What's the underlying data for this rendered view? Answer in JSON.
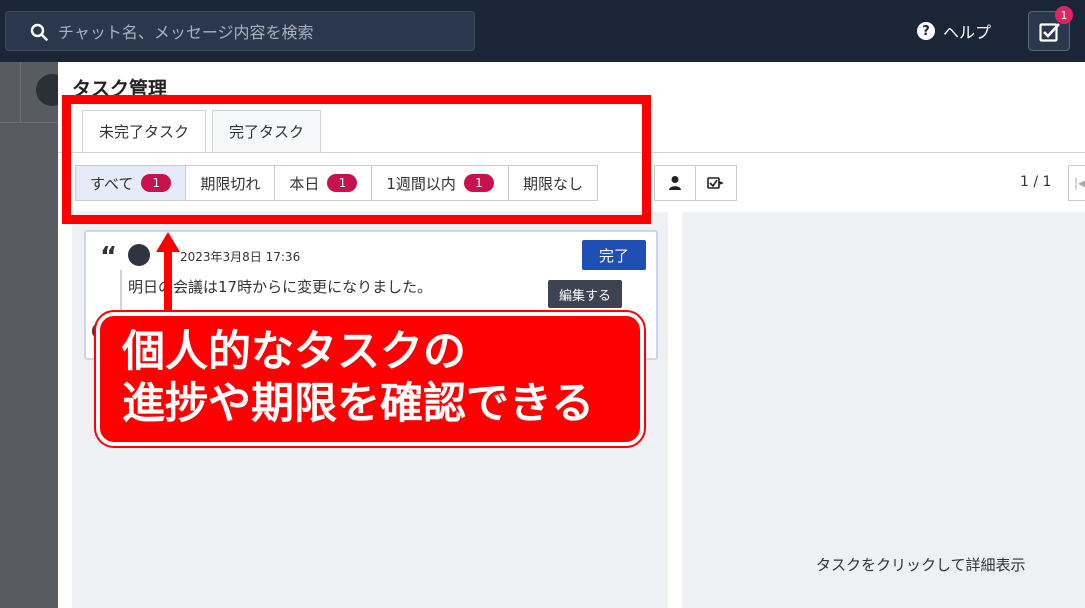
{
  "topbar": {
    "search_placeholder": "チャット名、メッセージ内容を検索",
    "help_label": "ヘルプ",
    "task_badge": "1"
  },
  "modal": {
    "title": "タスク管理",
    "tabs": [
      {
        "label": "未完了タスク",
        "active": true
      },
      {
        "label": "完了タスク",
        "active": false
      }
    ],
    "filters": [
      {
        "label": "すべて",
        "badge": "1",
        "active": true
      },
      {
        "label": "期限切れ",
        "badge": null
      },
      {
        "label": "本日",
        "badge": "1"
      },
      {
        "label": "1週間以内",
        "badge": "1"
      },
      {
        "label": "期限なし",
        "badge": null
      }
    ],
    "pager": "1 / 1",
    "task": {
      "date": "2023年3月8日 17:36",
      "message": "明日の会議は17時からに変更になりました。",
      "done_label": "完了",
      "edit_label": "編集する"
    },
    "detail_hint": "タスクをクリックして詳細表示"
  },
  "annotation": {
    "line1": "個人的なタスクの",
    "line2": "進捗や期限を確認できる",
    "color": "#ff0000"
  }
}
